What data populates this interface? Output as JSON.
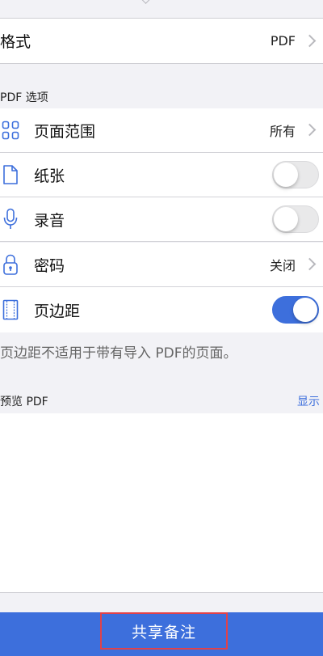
{
  "format": {
    "label": "格式",
    "value": "PDF"
  },
  "pdf_options": {
    "header": "PDF 选项",
    "rows": [
      {
        "label": "页面范围",
        "value": "所有",
        "icon": "grid-icon"
      },
      {
        "label": "纸张",
        "toggle": false,
        "icon": "page-icon"
      },
      {
        "label": "录音",
        "toggle": false,
        "icon": "microphone-icon"
      },
      {
        "label": "密码",
        "value": "关闭",
        "icon": "lock-icon"
      },
      {
        "label": "页边距",
        "toggle": true,
        "icon": "margin-icon"
      }
    ],
    "footnote": "页边距不适用于带有导入 PDF的页面。"
  },
  "preview": {
    "label": "预览 PDF",
    "link": "显示"
  },
  "share": {
    "label": "共享备注"
  },
  "colors": {
    "accent": "#3d6fdc",
    "highlight_border": "#e0424a"
  }
}
